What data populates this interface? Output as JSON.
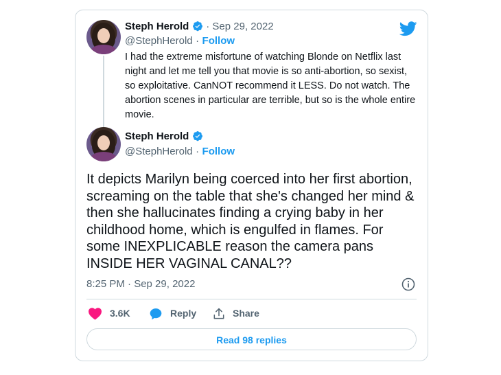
{
  "colors": {
    "accent": "#1d9bf0",
    "heart": "#f91880",
    "muted": "#536471",
    "border": "#cfd9de"
  },
  "brand_icon": "twitter-bird-icon",
  "parent_tweet": {
    "name": "Steph Herold",
    "separator_date": "· Sep 29, 2022",
    "handle": "@StephHerold",
    "dot": "·",
    "follow": "Follow",
    "text": "I had the extreme misfortune of watching Blonde on Netflix last night and let me tell you that movie is so anti-abortion, so sexist, so exploitative. CanNOT recommend it LESS. Do not watch. The abortion scenes in particular are terrible, but so is the whole entire movie."
  },
  "main_tweet": {
    "name": "Steph Herold",
    "handle": "@StephHerold",
    "dot": "·",
    "follow": "Follow",
    "text": "It depicts Marilyn being coerced into her first abortion,  screaming on the table that she's changed her mind & then she hallucinates finding a crying baby in her childhood home, which is engulfed in flames. For some INEXPLICABLE reason the camera pans INSIDE HER VAGINAL CANAL??",
    "timestamp": "8:25 PM · Sep 29, 2022",
    "info_icon": "info-icon"
  },
  "actions": {
    "likes": "3.6K",
    "reply": "Reply",
    "share": "Share"
  },
  "read_replies": "Read 98 replies"
}
